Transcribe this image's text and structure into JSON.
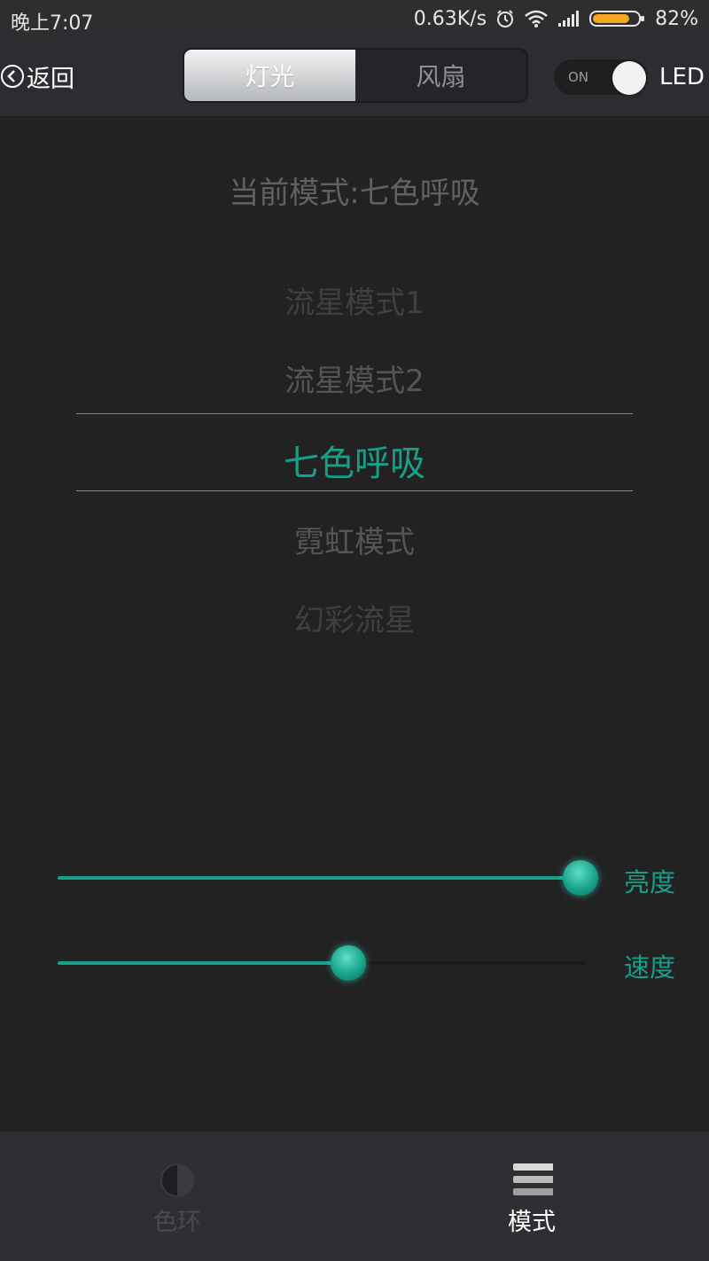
{
  "status_bar": {
    "time": "晚上7:07",
    "speed": "0.63K/s",
    "battery_percent": "82%",
    "battery_level": 0.82,
    "icons": [
      "alarm-icon",
      "wifi-icon",
      "signal-icon",
      "battery-icon"
    ]
  },
  "header": {
    "back_label": "返回",
    "tabs": [
      {
        "label": "灯光",
        "active": true
      },
      {
        "label": "风扇",
        "active": false
      }
    ],
    "toggle_label": "ON",
    "toggle_on": true,
    "device_label": "LED"
  },
  "mode_picker": {
    "current_prefix": "当前模式:",
    "current_value": "七色呼吸",
    "items": [
      "流星模式1",
      "流星模式2",
      "七色呼吸",
      "霓虹模式",
      "幻彩流星"
    ],
    "selected_index": 2
  },
  "sliders": {
    "brightness": {
      "label": "亮度",
      "value": 0.99
    },
    "speed": {
      "label": "速度",
      "value": 0.55
    }
  },
  "bottom_nav": {
    "items": [
      {
        "label": "色环",
        "icon": "color-wheel-icon",
        "active": false
      },
      {
        "label": "模式",
        "icon": "mode-list-icon",
        "active": true
      }
    ]
  },
  "colors": {
    "accent": "#16a08a",
    "background": "#222222",
    "bar": "#2c2d30",
    "battery": "#f5a623"
  }
}
